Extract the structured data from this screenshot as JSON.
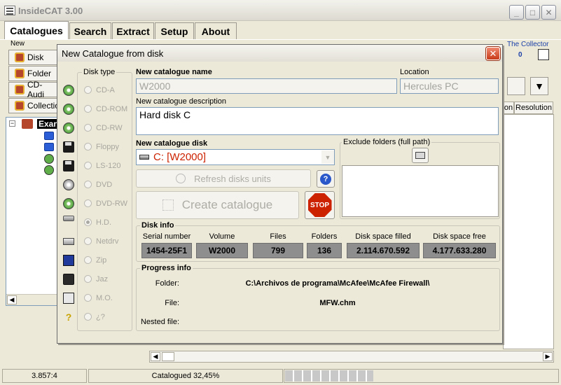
{
  "app": {
    "title": "InsideCAT 3.00"
  },
  "tabs": [
    "Catalogues",
    "Search",
    "Extract",
    "Setup",
    "About"
  ],
  "background": {
    "new_group_label": "New",
    "side_buttons": [
      "Disk",
      "Folder",
      "CD-Audi",
      "Collectio"
    ],
    "tree_root_label": "Exan",
    "collector_label": "The Collector",
    "collector_count": "0",
    "col_headers": [
      "on",
      "Resolution"
    ]
  },
  "dialog": {
    "title": "New Catalogue from disk",
    "disk_type": {
      "legend": "Disk type",
      "options": [
        "CD-A",
        "CD-ROM",
        "CD-RW",
        "Floppy",
        "LS-120",
        "DVD",
        "DVD-RW",
        "H.D.",
        "Netdrv",
        "Zip",
        "Jaz",
        "M.O.",
        "¿?"
      ],
      "icons": [
        "cd-icon",
        "cd-icon",
        "cd-icon",
        "floppy-icon",
        "floppy-icon",
        "dvd-icon",
        "dvd-icon",
        "hard-disk-icon",
        "network-drive-icon",
        "zip-disk-icon",
        "jaz-disk-icon",
        "mo-disk-icon",
        "unknown-disk-icon"
      ],
      "selected": "H.D."
    },
    "name": {
      "label": "New catalogue name",
      "value": "W2000"
    },
    "location": {
      "label": "Location",
      "value": "Hercules PC"
    },
    "description": {
      "label": "New catalogue description",
      "value": "Hard disk C"
    },
    "disk": {
      "label": "New catalogue disk",
      "value": "C: [W2000]"
    },
    "exclude": {
      "label": "Exclude folders (full path)"
    },
    "refresh_label": "Refresh disks units",
    "create_label": "Create catalogue",
    "stop_label": "STOP",
    "disk_info": {
      "legend": "Disk info",
      "headers": [
        "Serial number",
        "Volume",
        "Files",
        "Folders",
        "Disk space filled",
        "Disk space free"
      ],
      "values": [
        "1454-25F1",
        "W2000",
        "799",
        "136",
        "2.114.670.592",
        "4.177.633.280"
      ]
    },
    "progress_info": {
      "legend": "Progress info",
      "folder_label": "Folder:",
      "folder_value": "C:\\Archivos de programa\\McAfee\\McAfee Firewall\\",
      "file_label": "File:",
      "file_value": "MFW.chm",
      "nested_label": "Nested file:",
      "nested_value": ""
    }
  },
  "statusbar": {
    "left": "3.857:4",
    "middle": "Catalogued 32,45%",
    "progress_fraction": 0.3245
  },
  "colors": {
    "accent_red": "#cc2200",
    "disabled_text": "#a8a79f",
    "info_box": "#8e8e8e"
  }
}
